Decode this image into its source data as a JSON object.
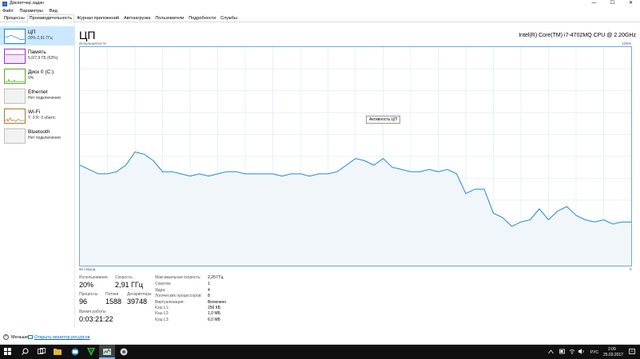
{
  "window": {
    "title": "Диспетчер задач",
    "minimize": "—",
    "maximize": "☐",
    "close": "✕"
  },
  "menu": [
    "Файл",
    "Параметры",
    "Вид"
  ],
  "tabs": [
    "Процессы",
    "Производительность",
    "Журнал приложений",
    "Автозагрузка",
    "Пользователи",
    "Подробности",
    "Службы"
  ],
  "active_tab": 1,
  "sidebar": [
    {
      "name": "ЦП",
      "sub": "20% 2,91 ГГц",
      "color": "#1e8ad6"
    },
    {
      "name": "Память",
      "sub": "5,0/7,9 ГБ (63%)",
      "color": "#9b30c8"
    },
    {
      "name": "Диск 0 (C:)",
      "sub": "0%",
      "color": "#4caf1a"
    },
    {
      "name": "Ethernet",
      "sub": "Нет подключения",
      "color": "#a0a0a0"
    },
    {
      "name": "Wi-Fi",
      "sub": "Т: 0 R: 0 кбит/с",
      "color": "#b0742a"
    },
    {
      "name": "Bluetooth",
      "sub": "Нет подключения",
      "color": "#a0a0a0"
    }
  ],
  "main": {
    "title": "ЦП",
    "cpu_name": "Intel(R) Core(TM) i7-4702MQ CPU @ 2.20GHz",
    "util_label": "Используется %",
    "util_max": "100%",
    "time_left": "60 секунд",
    "time_right": "0",
    "tooltip": "Активность ЦП"
  },
  "stats": {
    "usage_label": "Использование",
    "usage_value": "20%",
    "speed_label": "Скорость",
    "speed_value": "2,91 ГГц",
    "processes_label": "Процессы",
    "processes_value": "96",
    "threads_label": "Потоки",
    "threads_value": "1588",
    "handles_label": "Дескрипторы",
    "handles_value": "39748",
    "uptime_label": "Время работы",
    "uptime_value": "0:03:21:22"
  },
  "details": [
    {
      "k": "Максимальная скорость:",
      "v": "2,20 ГГц"
    },
    {
      "k": "Сокетов:",
      "v": "1"
    },
    {
      "k": "Ядра:",
      "v": "4"
    },
    {
      "k": "Логических процессоров:",
      "v": "8"
    },
    {
      "k": "Виртуализация:",
      "v": "Включено"
    },
    {
      "k": "Кэш L1:",
      "v": "256 КБ"
    },
    {
      "k": "Кэш L2:",
      "v": "1,0 МБ"
    },
    {
      "k": "Кэш L3:",
      "v": "6,0 МБ"
    }
  ],
  "footer": {
    "less": "Меньше",
    "monitor": "Открыть монитор ресурсов"
  },
  "taskbar": {
    "lang": "РУС",
    "time": "2:09",
    "date": "25.03.2017"
  },
  "chart_data": {
    "type": "area",
    "x_unit": "seconds ago",
    "xlim": [
      60,
      0
    ],
    "ylim": [
      0,
      100
    ],
    "grid": true,
    "color": "#1e8ad6",
    "fill": "#f1f6fb",
    "x": [
      60,
      59,
      58,
      57,
      56,
      55,
      54,
      53,
      52,
      51,
      50,
      49,
      48,
      47,
      46,
      45,
      44,
      43,
      42,
      41,
      40,
      39,
      38,
      37,
      36,
      35,
      34,
      33,
      32,
      31,
      30,
      29,
      28,
      27,
      26,
      25,
      24,
      23,
      22,
      21,
      20,
      19,
      18,
      17,
      16,
      15,
      14,
      13,
      12,
      11,
      10,
      9,
      8,
      7,
      6,
      5,
      4,
      3,
      2,
      1,
      0
    ],
    "values": [
      46,
      44,
      42,
      42,
      43,
      46,
      52,
      51,
      48,
      43,
      43,
      42,
      41,
      42,
      41,
      42,
      43,
      43,
      42,
      42,
      42,
      42,
      41,
      42,
      42,
      41,
      42,
      42,
      43,
      46,
      49,
      48,
      46,
      49,
      45,
      44,
      43,
      43,
      44,
      43,
      44,
      42,
      33,
      35,
      35,
      24,
      22,
      18,
      20,
      21,
      26,
      21,
      25,
      27,
      23,
      21,
      20,
      21,
      19,
      20,
      20
    ]
  }
}
